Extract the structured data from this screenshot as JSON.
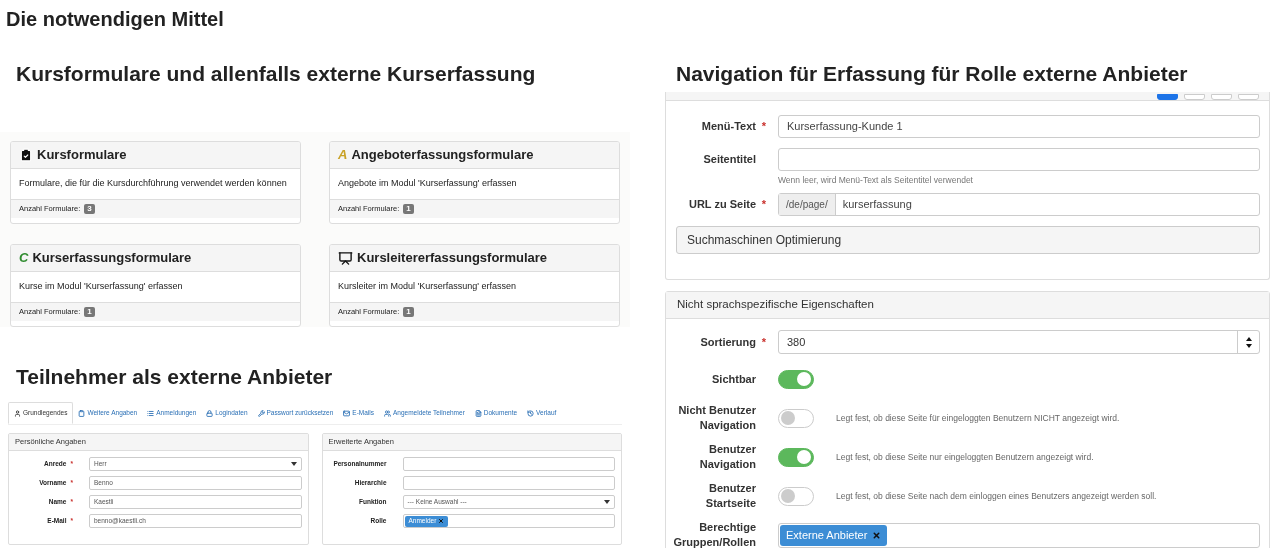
{
  "title": "Die notwendigen Mittel",
  "left": {
    "heading": "Kursformulare und allenfalls externe Kurserfassung",
    "cards": [
      {
        "kind": "icon",
        "title": "Kursformulare",
        "description": "Formulare, die für die Kursdurchführung verwendet werden können",
        "count_label": "Anzahl Formulare:",
        "count": "3"
      },
      {
        "kind": "letter",
        "letter": "A",
        "color": "#c9a227",
        "title": "Angeboterfassungsformulare",
        "description": "Angebote im Modul 'Kurserfassung' erfassen",
        "count_label": "Anzahl Formulare:",
        "count": "1"
      },
      {
        "kind": "letter",
        "letter": "C",
        "color": "#2e8b2e",
        "title": "Kurserfassungsformulare",
        "description": "Kurse im Modul 'Kurserfassung' erfassen",
        "count_label": "Anzahl Formulare:",
        "count": "1"
      },
      {
        "kind": "teacher",
        "title": "Kursleitererfassungsformulare",
        "description": "Kursleiter im Modul 'Kurserfassung' erfassen",
        "count_label": "Anzahl Formulare:",
        "count": "1"
      }
    ],
    "participants_heading": "Teilnehmer als externe Anbieter",
    "tabs": [
      {
        "label": "Grundlegendes",
        "selected": true
      },
      {
        "label": "Weitere Angaben",
        "selected": false
      },
      {
        "label": "Anmeldungen",
        "selected": false
      },
      {
        "label": "Logindaten",
        "selected": false
      },
      {
        "label": "Passwort zurücksetzen",
        "selected": false
      },
      {
        "label": "E-Mails",
        "selected": false
      },
      {
        "label": "Angemeldete Teilnehmer",
        "selected": false
      },
      {
        "label": "Dokumente",
        "selected": false
      },
      {
        "label": "Verlauf",
        "selected": false
      }
    ],
    "panels": [
      {
        "title": "Persönliche Angaben",
        "fields": [
          {
            "kind": "select",
            "label": "Anrede",
            "required_marker": "*",
            "value": "Herr"
          },
          {
            "kind": "text",
            "label": "Vorname",
            "required_marker": "*",
            "value": "Benno"
          },
          {
            "kind": "text",
            "label": "Name",
            "required_marker": "*",
            "value": "Kaestli"
          },
          {
            "kind": "text",
            "label": "E-Mail",
            "required_marker": "*",
            "value": "benno@kaestli.ch"
          }
        ]
      },
      {
        "title": "Erweiterte Angaben",
        "fields": [
          {
            "kind": "text",
            "label": "Personalnummer"
          },
          {
            "kind": "text",
            "label": "Hierarchie"
          },
          {
            "kind": "select",
            "label": "Funktion",
            "value": "--- Keine Auswahl ---"
          },
          {
            "kind": "tags",
            "label": "Rolle",
            "tags": [
              "Anmelder"
            ]
          }
        ]
      }
    ]
  },
  "right": {
    "heading": "Navigation für Erfassung für Rolle externe Anbieter",
    "toolbar_buttons": [
      {
        "selected": true
      },
      {
        "selected": false
      },
      {
        "selected": false
      },
      {
        "selected": false
      }
    ],
    "fields": [
      {
        "kind": "text",
        "label": "Menü-Text",
        "required_marker": "*",
        "value": "Kurserfassung-Kunde 1"
      },
      {
        "kind": "text",
        "label": "Seitentitel",
        "help": "Wenn leer, wird Menü-Text als Seitentitel verwendet"
      },
      {
        "kind": "prefixed",
        "label": "URL zu Seite",
        "required_marker": "*",
        "prefix": "/de/page/",
        "value": "kurserfassung"
      }
    ],
    "collapsible": "Suchmaschinen Optimierung",
    "panel_title": "Nicht sprachspezifische Eigenschaften",
    "properties": [
      {
        "kind": "number",
        "label": "Sortierung",
        "required_marker": "*",
        "value": "380"
      },
      {
        "kind": "toggle",
        "label": "Sichtbar",
        "on": true
      },
      {
        "kind": "toggle",
        "label": "Nicht Benutzer Navigation",
        "on": false,
        "help": "Legt fest, ob diese Seite für eingeloggten Benutzern NICHT angezeigt wird."
      },
      {
        "kind": "toggle",
        "label": "Benutzer Navigation",
        "on": true,
        "help": "Legt fest, ob diese Seite nur eingeloggten Benutzern angezeigt wird."
      },
      {
        "kind": "toggle",
        "label": "Benutzer Startseite",
        "on": false,
        "help": "Legt fest, ob diese Seite nach dem einloggen eines Benutzers angezeigt werden soll."
      },
      {
        "kind": "tags",
        "label": "Berechtige Gruppen/Rollen",
        "tags": [
          "Externe Anbieter"
        ]
      }
    ]
  }
}
